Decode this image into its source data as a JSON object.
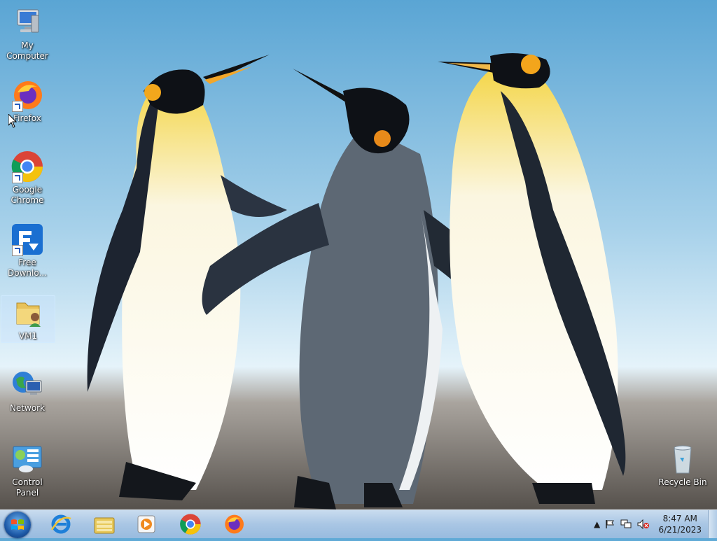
{
  "desktop": {
    "icons": [
      {
        "label": "My Computer"
      },
      {
        "label": "Firefox"
      },
      {
        "label": "Google Chrome"
      },
      {
        "label": "Free Downlo..."
      },
      {
        "label": "VM1"
      },
      {
        "label": "Network"
      },
      {
        "label": "Control Panel"
      },
      {
        "label": "Recycle Bin"
      }
    ],
    "selected_icon": "VM1"
  },
  "taskbar": {
    "pinned": [
      "internet-explorer-icon",
      "file-explorer-icon",
      "media-player-icon",
      "chrome-icon",
      "firefox-icon"
    ],
    "tray": {
      "time": "8:47 AM",
      "date": "6/21/2023"
    }
  },
  "colors": {
    "taskbar": "#a9c6e4",
    "sky": "#8cc3e3"
  }
}
